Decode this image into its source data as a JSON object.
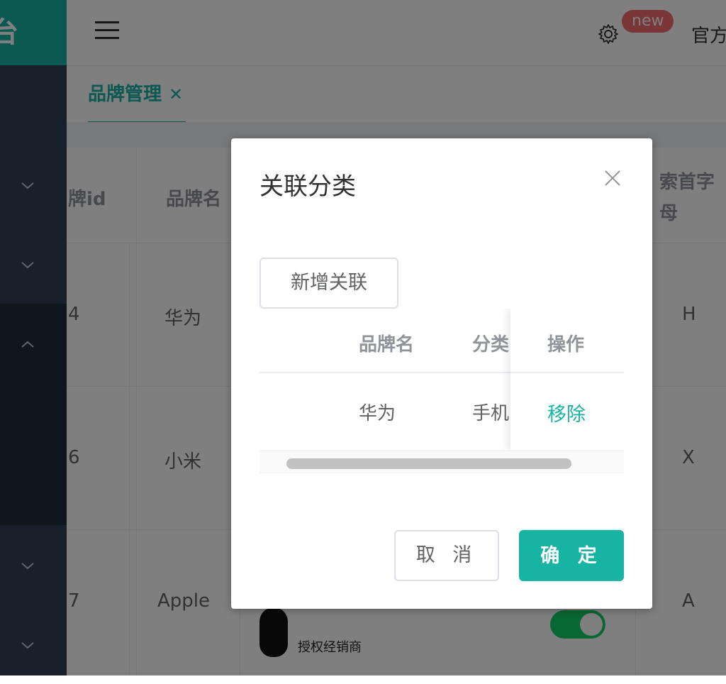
{
  "app": {
    "logo_text": "台",
    "official_text": "官方",
    "new_badge": "new"
  },
  "tab": {
    "label": "品牌管理",
    "close_glyph": "✕"
  },
  "table": {
    "headers": [
      "牌id",
      "品牌名",
      "索首字",
      "母"
    ],
    "rows": [
      {
        "id": "4",
        "name": "华为",
        "letter": "H"
      },
      {
        "id": "6",
        "name": "小米",
        "letter": "X"
      },
      {
        "id": "7",
        "name": "Apple",
        "letter": "A"
      }
    ],
    "logo_caption": "授权经销商"
  },
  "dialog": {
    "title": "关联分类",
    "add_button": "新增关联",
    "columns": {
      "brand": "品牌名",
      "category": "分类",
      "action": "操作"
    },
    "row": {
      "brand": "华为",
      "category": "手机",
      "action": "移除"
    },
    "cancel": "取 消",
    "confirm": "确 定"
  },
  "colors": {
    "accent": "#17b3a3",
    "sidebar": "#304156",
    "badge": "#f56c6c"
  },
  "icons": [
    "menu-icon",
    "gear-icon",
    "chevron-down-icon",
    "chevron-up-icon",
    "close-icon"
  ]
}
